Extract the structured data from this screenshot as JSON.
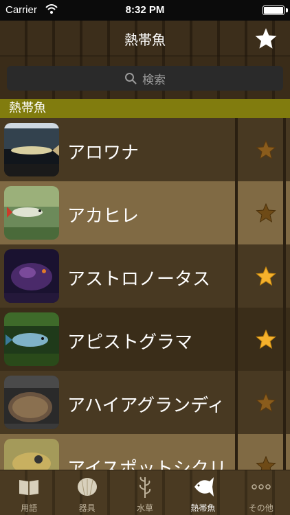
{
  "status": {
    "carrier": "Carrier",
    "time": "8:32 PM"
  },
  "nav": {
    "title": "熱帯魚"
  },
  "search": {
    "placeholder": "検索"
  },
  "section": {
    "title": "熱帯魚"
  },
  "items": [
    {
      "name": "アロワナ",
      "favorite": false
    },
    {
      "name": "アカヒレ",
      "favorite": false
    },
    {
      "name": "アストロノータス",
      "favorite": true
    },
    {
      "name": "アピストグラマ",
      "favorite": true
    },
    {
      "name": "アハイアグランディ",
      "favorite": false
    },
    {
      "name": "アイスポットシクリ",
      "favorite": false
    }
  ],
  "tabs": [
    {
      "label": "用語",
      "icon": "book-icon",
      "active": false
    },
    {
      "label": "器具",
      "icon": "shell-icon",
      "active": false
    },
    {
      "label": "水草",
      "icon": "plant-icon",
      "active": false
    },
    {
      "label": "熱帯魚",
      "icon": "fish-icon",
      "active": true
    },
    {
      "label": "その他",
      "icon": "more-icon",
      "active": false
    }
  ],
  "colors": {
    "section_header": "#817c0e",
    "star_active": "#f5b12c",
    "star_inactive": "#8a5c1c"
  }
}
